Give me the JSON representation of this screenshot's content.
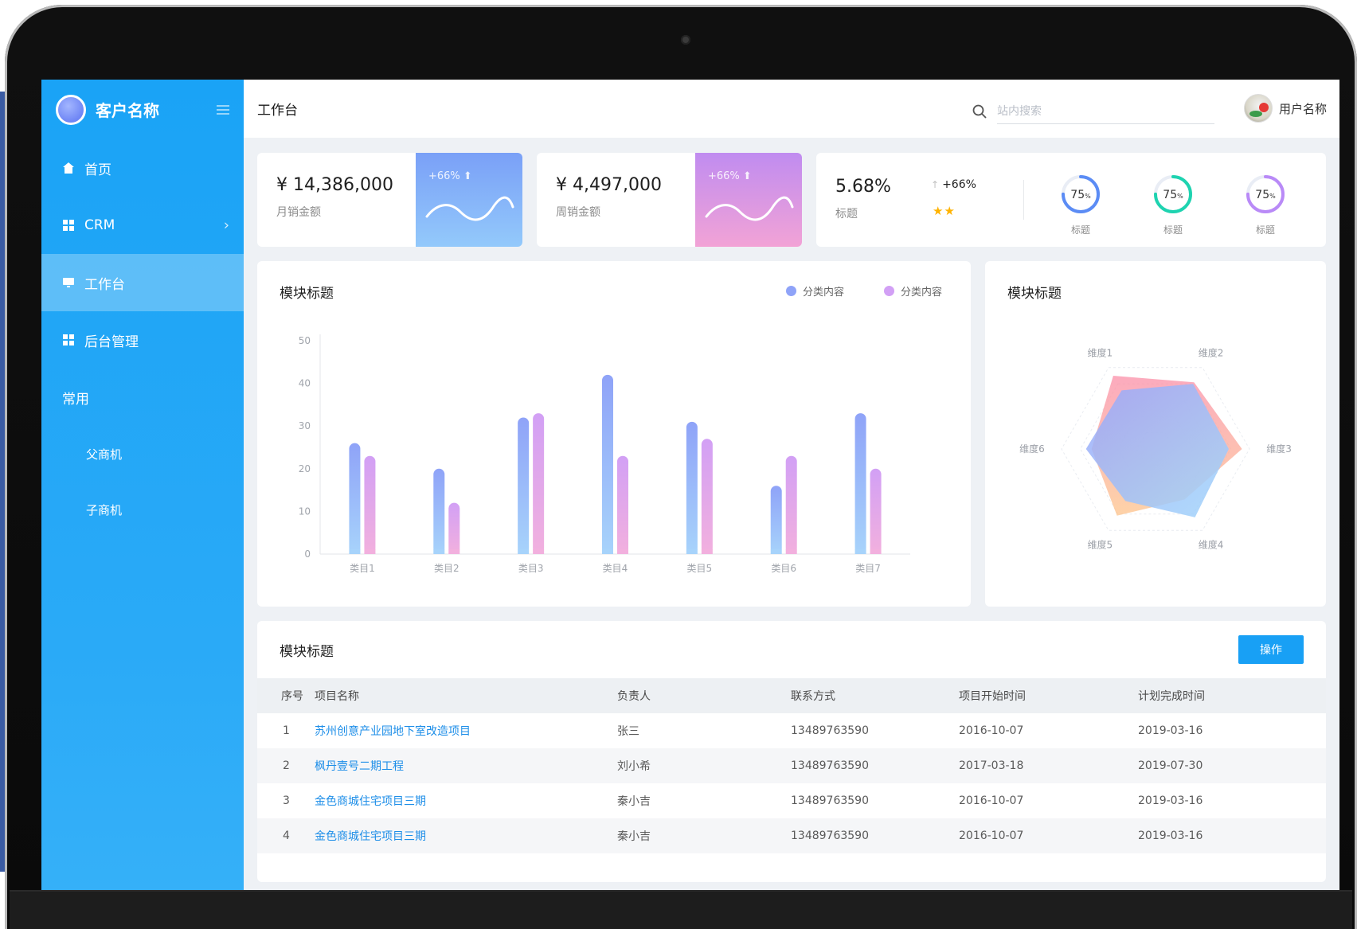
{
  "sidebar": {
    "brand": "客户名称",
    "items": [
      {
        "label": "首页",
        "icon": "home-icon"
      },
      {
        "label": "CRM",
        "icon": "grid-icon"
      },
      {
        "label": "工作台",
        "icon": "monitor-icon"
      },
      {
        "label": "后台管理",
        "icon": "grid-icon"
      }
    ],
    "group_label": "常用",
    "sub_items": [
      "父商机",
      "子商机"
    ]
  },
  "header": {
    "title": "工作台",
    "search_placeholder": "站内搜索",
    "user_name": "用户名称"
  },
  "kpis": [
    {
      "value": "¥ 14,386,000",
      "label": "月销金额",
      "badge": "+66% ⬆"
    },
    {
      "value": "¥ 4,497,000",
      "label": "周销金额",
      "badge": "+66% ⬆"
    }
  ],
  "kpi3": {
    "value": "5.68%",
    "label": "标题",
    "change": "+66%",
    "stars": "★★",
    "rings": [
      {
        "value": "75",
        "unit": "%",
        "label": "标题",
        "color": "#5b8cf5",
        "percent": 75
      },
      {
        "value": "75",
        "unit": "%",
        "label": "标题",
        "color": "#1ed3b0",
        "percent": 75
      },
      {
        "value": "75",
        "unit": "%",
        "label": "标题",
        "color": "#b98af7",
        "percent": 75
      }
    ]
  },
  "bar_panel": {
    "title": "模块标题",
    "legend": [
      "分类内容",
      "分类内容"
    ]
  },
  "radar_panel": {
    "title": "模块标题"
  },
  "table_panel": {
    "title": "模块标题",
    "action_label": "操作",
    "columns": [
      "序号",
      "项目名称",
      "负责人",
      "联系方式",
      "项目开始时间",
      "计划完成时间"
    ],
    "rows": [
      [
        "1",
        "苏州创意产业园地下室改造项目",
        "张三",
        "13489763590",
        "2016-10-07",
        "2019-03-16"
      ],
      [
        "2",
        "枫丹壹号二期工程",
        "刘小希",
        "13489763590",
        "2017-03-18",
        "2019-07-30"
      ],
      [
        "3",
        "金色商城住宅项目三期",
        "秦小吉",
        "13489763590",
        "2016-10-07",
        "2019-03-16"
      ],
      [
        "4",
        "金色商城住宅项目三期",
        "秦小吉",
        "13489763590",
        "2016-10-07",
        "2019-03-16"
      ]
    ]
  },
  "chart_data": [
    {
      "type": "bar",
      "title": "模块标题",
      "categories": [
        "类目1",
        "类目2",
        "类目3",
        "类目4",
        "类目5",
        "类目6",
        "类目7"
      ],
      "series": [
        {
          "name": "分类内容",
          "values": [
            26,
            20,
            32,
            42,
            31,
            16,
            33
          ],
          "color_top": "#8fa3f8",
          "color_bottom": "#a7d3fb"
        },
        {
          "name": "分类内容",
          "values": [
            23,
            12,
            33,
            23,
            27,
            23,
            20
          ],
          "color_top": "#d2a0f5",
          "color_bottom": "#f2b0de"
        }
      ],
      "ylim": [
        0,
        50
      ],
      "yticks": [
        0,
        10,
        20,
        30,
        40,
        50
      ],
      "grid": false,
      "legend": "top-right"
    },
    {
      "type": "radar",
      "axes": [
        "维度1",
        "维度2",
        "维度3",
        "维度4",
        "维度5",
        "维度6"
      ],
      "max": 100,
      "series": [
        {
          "values": [
            90,
            82,
            92,
            62,
            82,
            68
          ],
          "color": "#f6a0b4"
        },
        {
          "values": [
            72,
            80,
            78,
            84,
            64,
            74
          ],
          "color": "#9ab0f8"
        }
      ],
      "legend": "none"
    }
  ]
}
